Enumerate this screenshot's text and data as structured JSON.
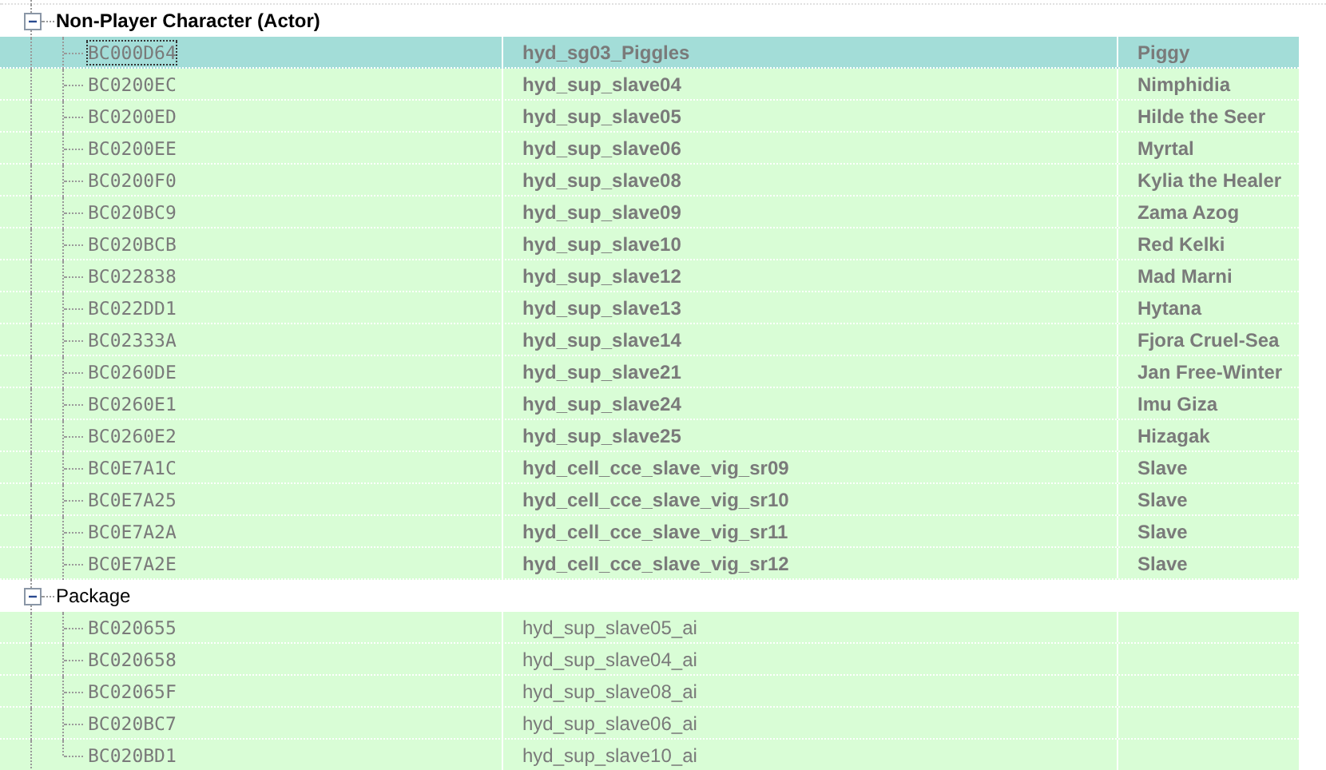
{
  "groups": [
    {
      "label": "Non-Player Character (Actor)",
      "expanded": true,
      "bold": true,
      "rows": [
        {
          "form_id": "BC000D64",
          "editor_id": "hyd_sg03_Piggles",
          "name": "Piggy",
          "selected": true
        },
        {
          "form_id": "BC0200EC",
          "editor_id": "hyd_sup_slave04",
          "name": "Nimphidia",
          "selected": false
        },
        {
          "form_id": "BC0200ED",
          "editor_id": "hyd_sup_slave05",
          "name": "Hilde the Seer",
          "selected": false
        },
        {
          "form_id": "BC0200EE",
          "editor_id": "hyd_sup_slave06",
          "name": "Myrtal",
          "selected": false
        },
        {
          "form_id": "BC0200F0",
          "editor_id": "hyd_sup_slave08",
          "name": "Kylia the Healer",
          "selected": false
        },
        {
          "form_id": "BC020BC9",
          "editor_id": "hyd_sup_slave09",
          "name": "Zama Azog",
          "selected": false
        },
        {
          "form_id": "BC020BCB",
          "editor_id": "hyd_sup_slave10",
          "name": "Red Kelki",
          "selected": false
        },
        {
          "form_id": "BC022838",
          "editor_id": "hyd_sup_slave12",
          "name": "Mad Marni",
          "selected": false
        },
        {
          "form_id": "BC022DD1",
          "editor_id": "hyd_sup_slave13",
          "name": "Hytana",
          "selected": false
        },
        {
          "form_id": "BC02333A",
          "editor_id": "hyd_sup_slave14",
          "name": "Fjora Cruel-Sea",
          "selected": false
        },
        {
          "form_id": "BC0260DE",
          "editor_id": "hyd_sup_slave21",
          "name": "Jan Free-Winter",
          "selected": false
        },
        {
          "form_id": "BC0260E1",
          "editor_id": "hyd_sup_slave24",
          "name": "Imu Giza",
          "selected": false
        },
        {
          "form_id": "BC0260E2",
          "editor_id": "hyd_sup_slave25",
          "name": "Hizagak",
          "selected": false
        },
        {
          "form_id": "BC0E7A1C",
          "editor_id": "hyd_cell_cce_slave_vig_sr09",
          "name": "Slave",
          "selected": false
        },
        {
          "form_id": "BC0E7A25",
          "editor_id": "hyd_cell_cce_slave_vig_sr10",
          "name": "Slave",
          "selected": false
        },
        {
          "form_id": "BC0E7A2A",
          "editor_id": "hyd_cell_cce_slave_vig_sr11",
          "name": "Slave",
          "selected": false
        },
        {
          "form_id": "BC0E7A2E",
          "editor_id": "hyd_cell_cce_slave_vig_sr12",
          "name": "Slave",
          "selected": false
        }
      ]
    },
    {
      "label": "Package",
      "expanded": true,
      "bold": false,
      "rows": [
        {
          "form_id": "BC020655",
          "editor_id": "hyd_sup_slave05_ai",
          "selected": false
        },
        {
          "form_id": "BC020658",
          "editor_id": "hyd_sup_slave04_ai",
          "selected": false
        },
        {
          "form_id": "BC02065F",
          "editor_id": "hyd_sup_slave08_ai",
          "selected": false
        },
        {
          "form_id": "BC020BC7",
          "editor_id": "hyd_sup_slave06_ai",
          "selected": false
        },
        {
          "form_id": "BC020BD1",
          "editor_id": "hyd_sup_slave10_ai",
          "selected": false
        }
      ]
    }
  ]
}
